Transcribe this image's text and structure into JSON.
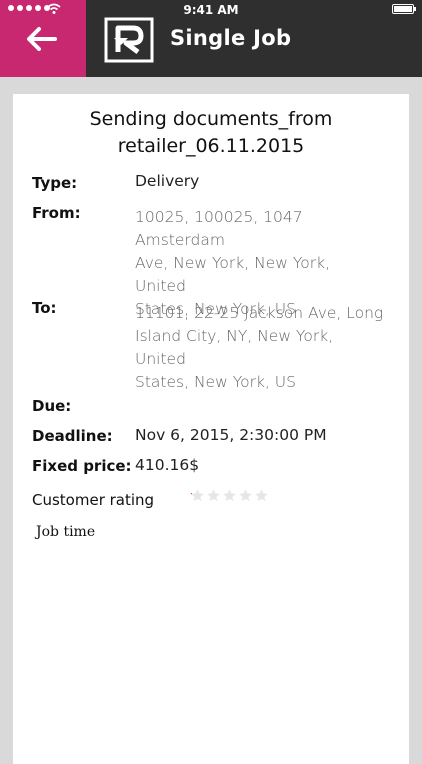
{
  "status": {
    "time": "9:41 AM"
  },
  "header": {
    "title": "Single Job",
    "back_icon": "back-arrow-icon",
    "logo_icon": "app-logo-icon"
  },
  "colors": {
    "header_bg": "#2f2f2f",
    "back_bg": "#c7286f",
    "page_bg": "#d9d9d9"
  },
  "job": {
    "title_line1": "Sending documents_from",
    "title_line2": "retailer_06.11.2015",
    "type_label": "Type:",
    "type_value": "Delivery",
    "from_label": "From:",
    "from_lines": [
      "10025, 100025, 1047 Amsterdam",
      "Ave, New York, New York, United",
      "States, New York, US"
    ],
    "to_label": "To:",
    "to_lines": [
      "11101, 22-25 Jackson Ave, Long",
      "Island City, NY, New York, United",
      "States, New York, US"
    ],
    "due_label": "Due:",
    "deadline_label": "Deadline:",
    "deadline_value": "Nov 6, 2015, 2:30:00 PM",
    "price_label": "Fixed price:",
    "price_value": "410.16$",
    "rating_label": "Customer rating",
    "rating_stars_total": 5,
    "rating_value": 0,
    "job_time_label": "Job time"
  }
}
